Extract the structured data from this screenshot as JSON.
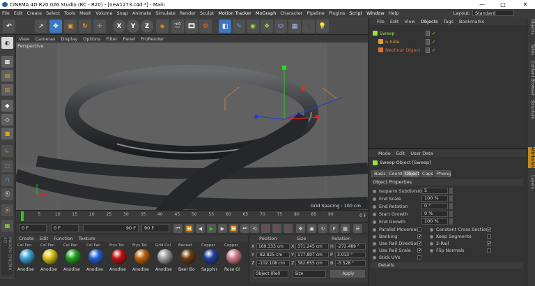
{
  "title": "CINEMA 4D R20.026 Studio (RC - R20) - [new1273.c4d *] - Main",
  "window_controls": [
    "—",
    "□",
    "✕"
  ],
  "menu": [
    "File",
    "Edit",
    "Create",
    "Select",
    "Tools",
    "Mesh",
    "Volume",
    "Snap",
    "Animate",
    "Simulate",
    "Render",
    "Sculpt",
    "Motion Tracker",
    "MoGraph",
    "Character",
    "Pipeline",
    "Plugins",
    "Script",
    "Window",
    "Help"
  ],
  "layout": {
    "label": "Layout:",
    "value": "Standard"
  },
  "toolbar": {
    "axis_x": "X",
    "axis_y": "Y",
    "axis_z": "Z",
    "icons": [
      "undo-icon",
      "live-selection-icon",
      "move-icon",
      "scale-icon",
      "rotate-icon",
      "last-tool-icon",
      "coordinate-system-icon",
      "render-view-icon",
      "render-picture-viewer-icon",
      "edit-render-settings-icon",
      "cube-icon",
      "pen-icon",
      "subdivision-surface-icon",
      "cloner-icon",
      "deformer-icon",
      "floor-icon",
      "camera-icon",
      "light-icon"
    ]
  },
  "viewport": {
    "menu": [
      "View",
      "Cameras",
      "Display",
      "Options",
      "Filter",
      "Panel",
      "ProRender"
    ],
    "label": "Perspective",
    "grid_spacing": "Grid Spacing : 100 cm"
  },
  "timeline": {
    "ticks": [
      "0",
      "5",
      "10",
      "15",
      "20",
      "25",
      "30",
      "35",
      "40",
      "45",
      "50",
      "55",
      "60",
      "65",
      "70",
      "75",
      "80",
      "85",
      "90"
    ],
    "frame_indicator": "0 F"
  },
  "playback": {
    "current": "0 F",
    "start": "0 F",
    "end_preview": "90 F",
    "end": "90 F"
  },
  "materials": {
    "menu": [
      "Create",
      "Edit",
      "Function",
      "Texture"
    ],
    "items": [
      {
        "caption": "Cel Pen",
        "name": "Anodise",
        "color": "#3aa0d0"
      },
      {
        "caption": "Cel Pen",
        "name": "Anodise",
        "color": "#d8c010"
      },
      {
        "caption": "Cel Pen",
        "name": "Anodise",
        "color": "#20a020"
      },
      {
        "caption": "Cel Pen",
        "name": "Anodise",
        "color": "#2060d0"
      },
      {
        "caption": "Frys Tet",
        "name": "Anodise",
        "color": "#c01010"
      },
      {
        "caption": "Frys Tet",
        "name": "Anodise",
        "color": "#c06010"
      },
      {
        "caption": "Grid Col",
        "name": "Anodise",
        "color": "#9a9a9a"
      },
      {
        "caption": "Beneat",
        "name": "Beer Bo",
        "color": "#6a3a10"
      },
      {
        "caption": "Copper",
        "name": "Sapphir",
        "color": "#2040a0"
      },
      {
        "caption": "Copper",
        "name": "Rose Gl",
        "color": "#d07a8a"
      }
    ]
  },
  "coords": {
    "headers": {
      "position": "Position",
      "size": "Size",
      "rotation": "Rotation"
    },
    "rows": [
      {
        "axis": "X",
        "pos": "169.333 cm",
        "size": "371.245 cm",
        "rot_axis": "H",
        "rot": "-272.489 °"
      },
      {
        "axis": "Y",
        "pos": "-82.825 cm",
        "size": "177.807 cm",
        "rot_axis": "P",
        "rot": "3.013 °"
      },
      {
        "axis": "Z",
        "pos": "-102.108 cm",
        "size": "382.655 cm",
        "rot_axis": "B",
        "rot": "-5.528 °"
      }
    ],
    "mode": "Object (Rel)",
    "size_mode": "Size",
    "apply": "Apply"
  },
  "objects": {
    "menu": [
      "File",
      "Edit",
      "View",
      "Objects",
      "Tags",
      "Bookmarks"
    ],
    "active_tab": "Objects",
    "items": [
      {
        "name": "Sweep",
        "color": "#9ae040",
        "indent": 0
      },
      {
        "name": "n-Side",
        "color": "#e0a030",
        "indent": 1
      },
      {
        "name": "Neolinur Object",
        "color": "#e07030",
        "indent": 1
      }
    ]
  },
  "attributes": {
    "menu": [
      "Mode",
      "Edit",
      "User Data"
    ],
    "object_title": "Sweep Object [Sweep]",
    "tabs": [
      "Basic",
      "Coord.",
      "Object",
      "Caps",
      "Phong"
    ],
    "active_tab": "Object",
    "section": "Object Properties",
    "props": [
      {
        "label": "Isoparm Subdivision",
        "value": "5"
      },
      {
        "label": "End Scale",
        "value": "100 %"
      },
      {
        "label": "End Rotation",
        "value": "0 °"
      },
      {
        "label": "Start Growth",
        "value": "0 %"
      },
      {
        "label": "End Growth",
        "value": "100 %"
      }
    ],
    "checks_left": [
      {
        "label": "Parallel Movement",
        "checked": false
      },
      {
        "label": "Banking",
        "checked": true
      },
      {
        "label": "Use Rail Direction",
        "checked": true
      },
      {
        "label": "Use Rail Scale",
        "checked": true
      },
      {
        "label": "Stick UVs",
        "checked": false
      }
    ],
    "checks_right": [
      {
        "label": "Constant Cross Section",
        "checked": true
      },
      {
        "label": "Keep Segments",
        "checked": false
      },
      {
        "label": "2-Rail",
        "checked": true
      },
      {
        "label": "Flip Normals",
        "checked": false
      }
    ],
    "details": "Details"
  },
  "side_tabs": [
    "Objects",
    "Takes",
    "Content Browser",
    "Structure",
    "Attributes",
    "Layers"
  ],
  "active_side_tab": "Attributes"
}
